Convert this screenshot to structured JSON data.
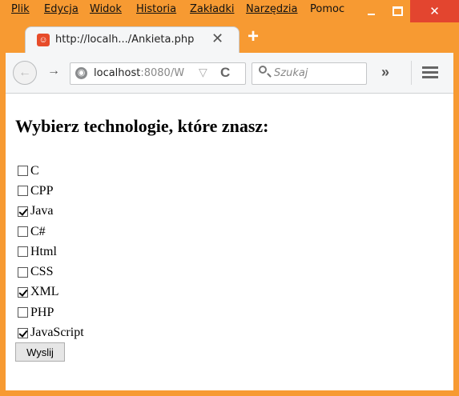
{
  "window": {
    "menu": [
      "Plik",
      "Edycja",
      "Widok",
      "Historia",
      "Zakładki",
      "Narzędzia",
      "Pomoc"
    ],
    "controls": {
      "close_glyph": "✕"
    }
  },
  "tab": {
    "title": "http://localh.../Ankieta.php",
    "close_glyph": "✕",
    "favicon_icon": "firefox-page-icon"
  },
  "newtab_glyph": "+",
  "nav": {
    "back_glyph": "←",
    "forward_glyph": "→",
    "url_host": "localhost",
    "url_rest": ":8080/W",
    "reload_glyph": "C",
    "search_placeholder": "Szukaj",
    "overflow_glyph": "»"
  },
  "page": {
    "heading": "Wybierz technologie, które znasz:",
    "options": [
      {
        "label": "C",
        "checked": false
      },
      {
        "label": "CPP",
        "checked": false
      },
      {
        "label": "Java",
        "checked": true
      },
      {
        "label": "C#",
        "checked": false
      },
      {
        "label": "Html",
        "checked": false
      },
      {
        "label": "CSS",
        "checked": false
      },
      {
        "label": "XML",
        "checked": true
      },
      {
        "label": "PHP",
        "checked": false
      },
      {
        "label": "JavaScript",
        "checked": true
      }
    ],
    "submit_label": "Wyslij"
  },
  "colors": {
    "frame": "#f79a32",
    "close": "#e3452f"
  }
}
